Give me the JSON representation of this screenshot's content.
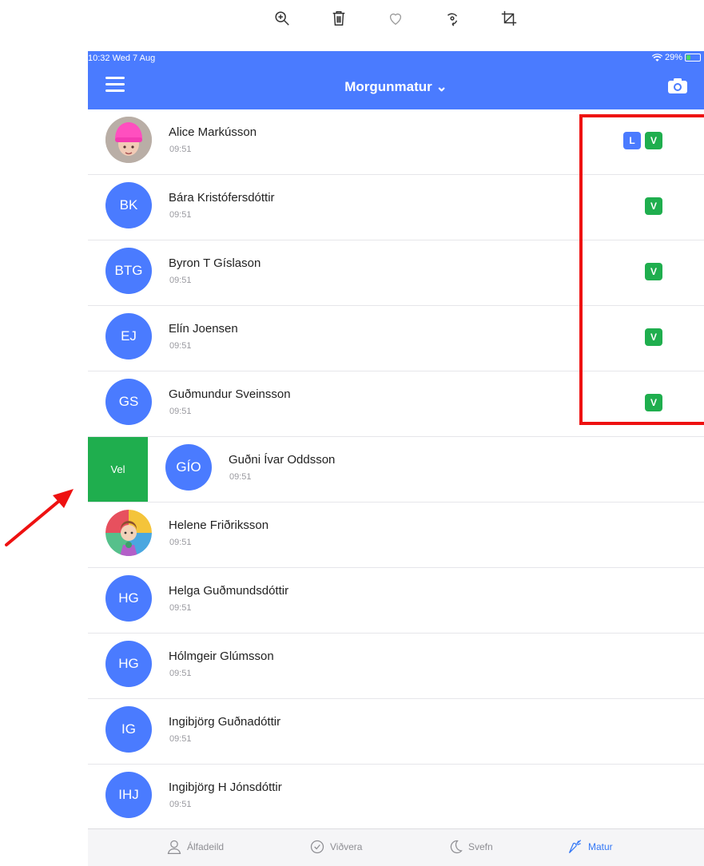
{
  "editor_toolbar": {
    "icons": [
      "zoom-in-icon",
      "trash-icon",
      "heart-icon",
      "rotate-icon",
      "crop-icon"
    ]
  },
  "status_bar": {
    "time": "10:32  Wed 7 Aug",
    "battery": "29%",
    "battery_level": 0.29
  },
  "nav": {
    "title": "Morgunmatur ⌄"
  },
  "rows": [
    {
      "name": "Alice Markússon",
      "time": "09:51",
      "initials": "",
      "photo": "girl-pink-hat",
      "badges": [
        "L",
        "V"
      ]
    },
    {
      "name": "Bára Kristófersdóttir",
      "time": "09:51",
      "initials": "BK",
      "badges": [
        "V"
      ]
    },
    {
      "name": "Byron T Gíslason",
      "time": "09:51",
      "initials": "BTG",
      "badges": [
        "V"
      ]
    },
    {
      "name": "Elín Joensen",
      "time": "09:51",
      "initials": "EJ",
      "badges": [
        "V"
      ]
    },
    {
      "name": "Guðmundur Sveinsson",
      "time": "09:51",
      "initials": "GS",
      "badges": [
        "V"
      ]
    },
    {
      "name": "Guðni Ívar Oddsson",
      "time": "09:51",
      "initials": "GÍO",
      "badges": [],
      "swipe_action": "Vel"
    },
    {
      "name": "Helene Friðriksson",
      "time": "09:51",
      "initials": "",
      "photo": "cartoon-avatar",
      "badges": []
    },
    {
      "name": "Helga Guðmundsdóttir",
      "time": "09:51",
      "initials": "HG",
      "badges": []
    },
    {
      "name": "Hólmgeir Glúmsson",
      "time": "09:51",
      "initials": "HG",
      "badges": []
    },
    {
      "name": "Ingibjörg Guðnadóttir",
      "time": "09:51",
      "initials": "IG",
      "badges": []
    },
    {
      "name": "Ingibjörg H Jónsdóttir",
      "time": "09:51",
      "initials": "IHJ",
      "badges": []
    }
  ],
  "tabs": [
    {
      "label": "Álfadeild",
      "icon": "person-icon",
      "active": false
    },
    {
      "label": "Viðvera",
      "icon": "checkmark-circle-icon",
      "active": false
    },
    {
      "label": "Svefn",
      "icon": "moon-icon",
      "active": false
    },
    {
      "label": "Matur",
      "icon": "carrot-icon",
      "active": true
    }
  ],
  "colors": {
    "brand": "#4a7bff",
    "badge_green": "#1fae4e",
    "annotation_red": "#ee1111",
    "tab_active": "#3478f6"
  }
}
